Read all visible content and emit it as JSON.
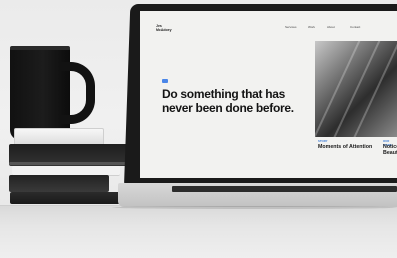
{
  "website": {
    "logo_line1": "Jes",
    "logo_line2": "McAdoey",
    "nav": [
      "Services",
      "Work",
      "About",
      "Contact"
    ],
    "headline": "Do something that has never been done before.",
    "cards": [
      {
        "label": "STORY",
        "title": "Moments of Attention"
      },
      {
        "label": "OUR WORK",
        "title": "Notice Beaut"
      }
    ]
  }
}
